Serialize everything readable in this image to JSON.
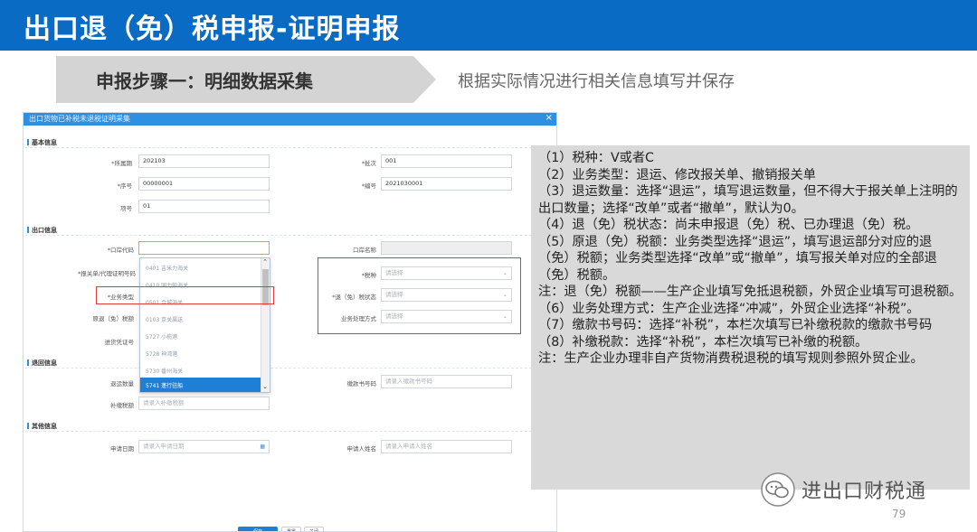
{
  "header": {
    "title": "出口退（免）税申报-证明申报"
  },
  "step": {
    "label": "申报步骤一：明细数据采集",
    "description": "根据实际情况进行相关信息填写并保存"
  },
  "dialog": {
    "title": "出口货物已补税未退税证明采集",
    "close": "×",
    "sections": {
      "basic": "基本信息",
      "export": "出口信息",
      "refund": "退回信息",
      "other": "其他信息"
    },
    "fields": {
      "period": {
        "label": "*所属期",
        "value": "202103"
      },
      "batch": {
        "label": "*批次",
        "value": "001"
      },
      "seq": {
        "label": "*序号",
        "value": "00000001"
      },
      "number": {
        "label": "*编号",
        "value": "2021030001"
      },
      "item": {
        "label": "项号",
        "value": "01"
      },
      "port_code": {
        "label": "*口岸代码",
        "value": ""
      },
      "port_name": {
        "label": "口岸名称",
        "value": ""
      },
      "customs_no": {
        "label": "*报关单/代理证明号码",
        "value": ""
      },
      "tax_type": {
        "label": "*税种",
        "value": "请选择"
      },
      "biz_type": {
        "label": "*业务类型",
        "value": ""
      },
      "refund_status": {
        "label": "*退（免）税状态",
        "value": "请选择"
      },
      "orig_tax": {
        "label": "原退（免）税额",
        "value": ""
      },
      "biz_method": {
        "label": "业务处理方式",
        "value": "请选择"
      },
      "voucher": {
        "label": "进货凭证号",
        "value": ""
      },
      "refund_qty": {
        "label": "退运数量",
        "value": ""
      },
      "payment_no": {
        "label": "缴款书号码",
        "value": "请录入缴款书号码"
      },
      "supp_tax": {
        "label": "补缴税额",
        "value": "请录入补缴税额"
      },
      "apply_date": {
        "label": "申请日期",
        "value": "请录入申请日期"
      },
      "applicant": {
        "label": "申请人姓名",
        "value": "请录入申请人姓名"
      }
    },
    "dropdown": {
      "items": [
        "0401 吉米力海关",
        "0410 国力船海关",
        "0501 合城海关",
        "0103 京关属送",
        "5727 小榄港",
        "5728 神湾港",
        "5730 番州海关",
        "5741 蓬行驻船"
      ],
      "selected_index": 7
    },
    "buttons": {
      "save": "保存",
      "b2": "重置",
      "b3": "关闭"
    }
  },
  "notes": [
    "（1）税种：V或者C",
    "（2）业务类型：退运、修改报关单、撤销报关单",
    "（3）退运数量：选择“退运”，填写退运数量，但不得大于报关单上注明的出口数量；选择“改单”或者“撤单”，默认为0。",
    "（4）退（免）税状态：尚未申报退（免）税、已办理退（免）税。",
    "（5）原退（免）税额：业务类型选择“退运”，填写退运部分对应的退（免）税额；业务类型选择“改单”或“撤单”，填写报关单对应的全部退（免）税额。",
    "注：退（免）税额——生产企业填写免抵退税额，外贸企业填写可退税额。",
    "（6）业务处理方式：生产企业选择“冲减”，外贸企业选择“补税”。",
    "（7）缴款书号码：选择“补税”，本栏次填写已补缴税款的缴款书号码",
    "（8）补缴税款：选择“补税”，本栏次填写已补缴的税额。",
    "注：生产企业办理非自产货物消费税退税的填写规则参照外贸企业。"
  ],
  "watermark": {
    "text": "进出口财税通",
    "icon": "wechat-icon"
  },
  "page_number": "79",
  "colors": {
    "header": "#0a6bc4",
    "highlight": "#e23b3b",
    "selected": "#1f7fd6",
    "notes_bg": "#d9d9d9"
  }
}
